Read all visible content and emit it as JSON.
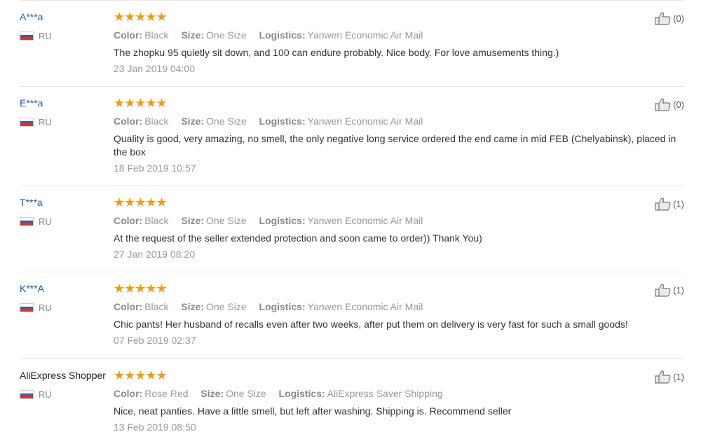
{
  "labels": {
    "color": "Color:",
    "size": "Size:",
    "logistics": "Logistics:"
  },
  "reviews": [
    {
      "user": "A***a",
      "country": "RU",
      "color": "Black",
      "size": "One Size",
      "logistics": "Yanwen Economic Air Mail",
      "text": "The zhopku 95 quietly sit down, and 100 can endure probably. Nice body. For love amusements thing.)",
      "date": "23 Jan 2019 04:00",
      "likes": "(0)"
    },
    {
      "user": "E***a",
      "country": "RU",
      "color": "Black",
      "size": "One Size",
      "logistics": "Yanwen Economic Air Mail",
      "text": "Quality is good, very amazing, no smell, the only negative long service ordered the end came in mid FEB (Chelyabinsk), placed in the box",
      "date": "18 Feb 2019 10:57",
      "likes": "(0)"
    },
    {
      "user": "T***a",
      "country": "RU",
      "color": "Black",
      "size": "One Size",
      "logistics": "Yanwen Economic Air Mail",
      "text": "At the request of the seller extended protection and soon came to order)) Thank You)",
      "date": "27 Jan 2019 08:20",
      "likes": "(1)"
    },
    {
      "user": "K***A",
      "country": "RU",
      "color": "Black",
      "size": "One Size",
      "logistics": "Yanwen Economic Air Mail",
      "text": "Chic pants! Her husband of recalls even after two weeks, after put them on delivery is very fast for such a small goods!",
      "date": "07 Feb 2019 02:37",
      "likes": "(1)"
    },
    {
      "user": "AliExpress Shopper",
      "country": "RU",
      "color": "Rose Red",
      "size": "One Size",
      "logistics": "AliExpress Saver Shipping",
      "text": "Nice, neat panties. Have a little smell, but left after washing. Shipping is. Recommend seller",
      "date": "13 Feb 2019 08:50",
      "likes": "(1)"
    }
  ],
  "rating_stars": "★★★★★",
  "colors": {
    "star": "#f29b12",
    "username": "#1f5fa8",
    "muted": "#9a9a9a"
  },
  "icons": {
    "flag": "russia-flag-icon",
    "like": "thumbs-up-icon"
  }
}
